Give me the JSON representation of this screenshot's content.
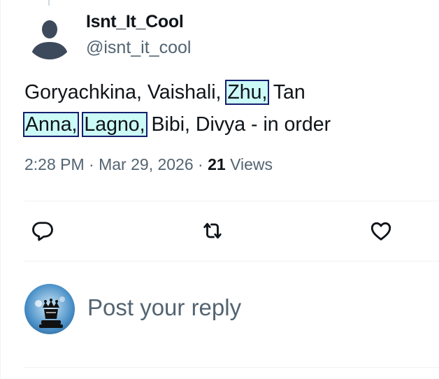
{
  "author": {
    "name": "Isnt_It_Cool",
    "handle": "@isnt_it_cool"
  },
  "tweet": {
    "segments": {
      "s1": "Goryachkina, Vaishali, ",
      "zhu": "Zhu,",
      "s2": " Tan",
      "anna": "Anna,",
      "s3": " ",
      "lagno": "Lagno,",
      "s4": " Bibi, Divya - in order"
    }
  },
  "meta": {
    "time": "2:28 PM",
    "separator": "·",
    "date": "Mar 29, 2026",
    "views_count": "21",
    "views_label": "Views"
  },
  "actions": {
    "reply_icon": "reply-icon",
    "retweet_icon": "retweet-icon",
    "like_icon": "heart-icon"
  },
  "reply": {
    "placeholder": "Post your reply"
  },
  "colors": {
    "text_primary": "#0f1419",
    "text_secondary": "#536471",
    "divider": "#eff3f4",
    "highlight_fill": "#ccfaf7",
    "highlight_border": "#141e6e"
  }
}
